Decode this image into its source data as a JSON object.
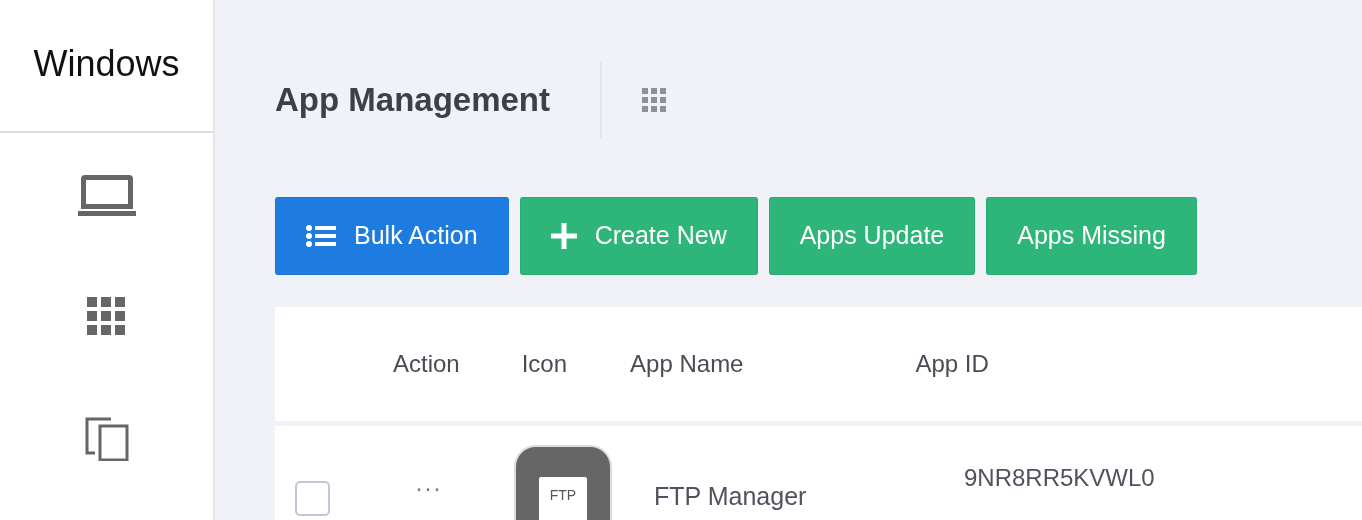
{
  "sidebar": {
    "title": "Windows",
    "items": [
      {
        "kind": "laptop"
      },
      {
        "kind": "grid"
      },
      {
        "kind": "copy"
      }
    ]
  },
  "header": {
    "title": "App Management"
  },
  "toolbar": {
    "buttons": [
      {
        "label": "Bulk Action",
        "kind": "list",
        "color": "#1e7be0"
      },
      {
        "label": "Create New",
        "kind": "plus",
        "color": "#2db57a"
      },
      {
        "label": "Apps Update",
        "kind": "plain",
        "color": "#2db57a"
      },
      {
        "label": "Apps Missing",
        "kind": "plain",
        "color": "#2db57a"
      }
    ]
  },
  "table": {
    "columns": [
      "Action",
      "Icon",
      "App Name",
      "App ID"
    ],
    "rows": [
      {
        "checked": false,
        "action": "···",
        "icon_label": "FTP",
        "app_name": "FTP Manager",
        "app_id": "9NR8RR5KVWL0"
      }
    ]
  }
}
